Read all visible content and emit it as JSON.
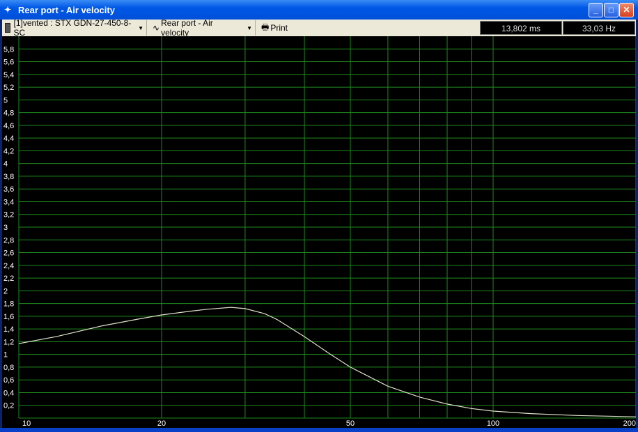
{
  "window": {
    "title": "Rear port - Air velocity",
    "minimize": "_",
    "maximize": "□",
    "close": "✕"
  },
  "toolbar": {
    "project": "[1]vented : STX GDN-27-450-8-SC",
    "graph": "Rear port - Air velocity",
    "print": "Print",
    "time_readout": "13,802 ms",
    "freq_readout": "33,03 Hz"
  },
  "chart_data": {
    "type": "line",
    "title": "Rear port - Air velocity",
    "xscale": "log",
    "xlim": [
      10,
      200
    ],
    "ylim": [
      0,
      6
    ],
    "x_ticks": [
      10,
      20,
      50,
      100,
      200
    ],
    "x_tick_labels": [
      "10",
      "20",
      "50",
      "100",
      "200"
    ],
    "x_grid": [
      10,
      20,
      30,
      40,
      50,
      60,
      70,
      80,
      90,
      100,
      200
    ],
    "y_ticks": [
      0.2,
      0.4,
      0.6,
      0.8,
      1,
      1.2,
      1.4,
      1.6,
      1.8,
      2,
      2.2,
      2.4,
      2.6,
      2.8,
      3,
      3.2,
      3.4,
      3.6,
      3.8,
      4,
      4.2,
      4.4,
      4.6,
      4.8,
      5,
      5.2,
      5.4,
      5.6,
      5.8
    ],
    "y_tick_labels": [
      "0,2",
      "0,4",
      "0,6",
      "0,8",
      "1",
      "1,2",
      "1,4",
      "1,6",
      "1,8",
      "2",
      "2,2",
      "2,4",
      "2,6",
      "2,8",
      "3",
      "3,2",
      "3,4",
      "3,6",
      "3,8",
      "4",
      "4,2",
      "4,4",
      "4,6",
      "4,8",
      "5",
      "5,2",
      "5,4",
      "5,6",
      "5,8"
    ],
    "grid": true,
    "colors": {
      "grid": "#1e8c1e",
      "line": "#e0e0c8",
      "background": "#000000"
    },
    "series": [
      {
        "name": "Air velocity",
        "x": [
          10,
          12,
          15,
          18,
          20,
          23,
          25,
          28,
          30,
          33,
          35,
          40,
          45,
          50,
          60,
          70,
          80,
          90,
          100,
          120,
          150,
          200
        ],
        "y": [
          1.17,
          1.28,
          1.45,
          1.56,
          1.62,
          1.68,
          1.71,
          1.74,
          1.72,
          1.64,
          1.55,
          1.28,
          1.02,
          0.8,
          0.5,
          0.33,
          0.22,
          0.15,
          0.11,
          0.07,
          0.04,
          0.02
        ]
      }
    ]
  }
}
